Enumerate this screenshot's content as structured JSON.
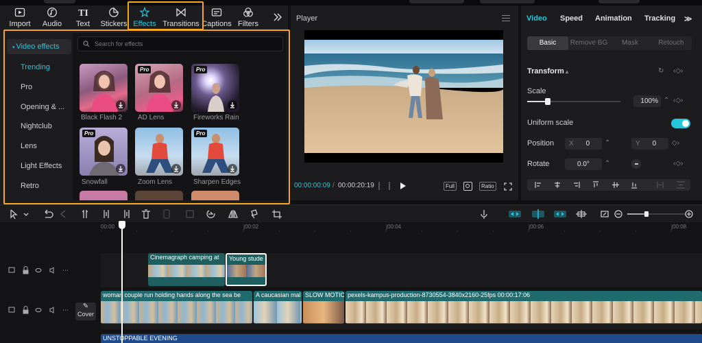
{
  "toolbar": {
    "tabs": [
      {
        "label": "Import",
        "icon": "import-icon"
      },
      {
        "label": "Audio",
        "icon": "audio-icon"
      },
      {
        "label": "Text",
        "icon": "text-icon"
      },
      {
        "label": "Stickers",
        "icon": "stickers-icon"
      },
      {
        "label": "Effects",
        "icon": "effects-icon",
        "active": true
      },
      {
        "label": "Transitions",
        "icon": "transitions-icon"
      },
      {
        "label": "Captions",
        "icon": "captions-icon"
      },
      {
        "label": "Filters",
        "icon": "filters-icon"
      }
    ],
    "more_icon": "chevron-double-right-icon"
  },
  "effects_panel": {
    "category_header": "Video effects",
    "categories": [
      "Trending",
      "Pro",
      "Opening & ...",
      "Nightclub",
      "Lens",
      "Light Effects",
      "Retro"
    ],
    "active_category": "Trending",
    "search": {
      "placeholder": "Search for effects",
      "value": ""
    },
    "items": [
      {
        "label": "Black Flash 2",
        "pro": false,
        "pro_label": ""
      },
      {
        "label": "AD Lens",
        "pro": true,
        "pro_label": "Pro"
      },
      {
        "label": "Fireworks Rain",
        "pro": true,
        "pro_label": "Pro"
      },
      {
        "label": "Snowfall",
        "pro": true,
        "pro_label": "Pro"
      },
      {
        "label": "Zoom Lens",
        "pro": false,
        "pro_label": ""
      },
      {
        "label": "Sharpen Edges",
        "pro": true,
        "pro_label": "Pro"
      }
    ]
  },
  "player": {
    "title": "Player",
    "current_time": "00:00:00:09",
    "total_time": "00:00:20:19",
    "full_label": "Full",
    "ratio_label": "Ratio"
  },
  "properties": {
    "tabs": [
      "Video",
      "Speed",
      "Animation",
      "Tracking"
    ],
    "active_tab": "Video",
    "subtabs": [
      "Basic",
      "Remove BG",
      "Mask",
      "Retouch"
    ],
    "active_subtab": "Basic",
    "transform_label": "Transform",
    "scale_label": "Scale",
    "scale_value": "100%",
    "uniform_scale_label": "Uniform scale",
    "uniform_scale_on": true,
    "position_label": "Position",
    "pos_x_label": "X",
    "pos_x_value": "0",
    "pos_y_label": "Y",
    "pos_y_value": "0",
    "rotate_label": "Rotate",
    "rotate_value": "0.0°"
  },
  "timeline": {
    "ruler_labels": [
      "00:00",
      "|00:02",
      "|00:04",
      "|00:06",
      "|00:08"
    ],
    "cover_label": "Cover",
    "overlay_clips": [
      "Cinemagraph camping at",
      "Young stude"
    ],
    "main_clips": [
      "woman couple run holding hands along the sea be",
      "A caucasian mal",
      "SLOW MOTIC",
      "pexels-kampus-production-8730554-3840x2160-25fps  00:00:17:06"
    ],
    "text_clip": "UNSTOPPABLE EVENING"
  }
}
